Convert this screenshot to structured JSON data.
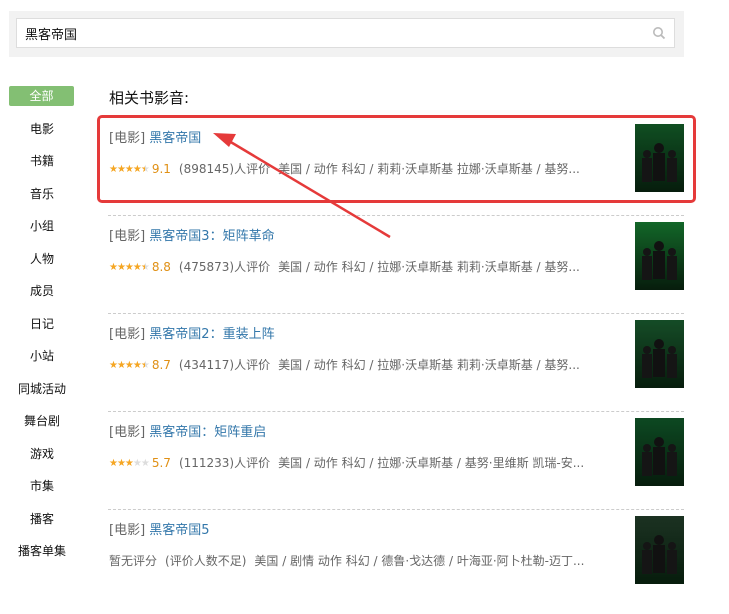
{
  "search": {
    "value": "黑客帝国"
  },
  "sidebar": {
    "items": [
      {
        "label": "全部",
        "active": true
      },
      {
        "label": "电影"
      },
      {
        "label": "书籍"
      },
      {
        "label": "音乐"
      },
      {
        "label": "小组"
      },
      {
        "label": "人物"
      },
      {
        "label": "成员"
      },
      {
        "label": "日记"
      },
      {
        "label": "小站"
      },
      {
        "label": "同城活动"
      },
      {
        "label": "舞台剧"
      },
      {
        "label": "游戏"
      },
      {
        "label": "市集"
      },
      {
        "label": "播客"
      },
      {
        "label": "播客单集"
      }
    ]
  },
  "section_title": "相关书影音:",
  "results": [
    {
      "category": "[电影]",
      "title": "黑客帝国",
      "stars": 4.5,
      "score": "9.1",
      "count": "(898145)人评价",
      "info": "美国 / 动作 科幻 / 莉莉·沃卓斯基 拉娜·沃卓斯基 / 基努...",
      "poster_color": "#0b3d1a"
    },
    {
      "category": "[电影]",
      "title": "黑客帝国3：矩阵革命",
      "stars": 4.5,
      "score": "8.8",
      "count": "(475873)人评价",
      "info": "美国 / 动作 科幻 / 拉娜·沃卓斯基 莉莉·沃卓斯基 / 基努...",
      "poster_color": "#0f5a22"
    },
    {
      "category": "[电影]",
      "title": "黑客帝国2：重装上阵",
      "stars": 4.5,
      "score": "8.7",
      "count": "(434117)人评价",
      "info": "美国 / 动作 科幻 / 拉娜·沃卓斯基 莉莉·沃卓斯基 / 基努...",
      "poster_color": "#123a20"
    },
    {
      "category": "[电影]",
      "title": "黑客帝国：矩阵重启",
      "stars": 3,
      "score": "5.7",
      "count": "(111233)人评价",
      "info": "美国 / 动作 科幻 / 拉娜·沃卓斯基 / 基努·里维斯 凯瑞-安...",
      "poster_color": "#08361a"
    },
    {
      "category": "[电影]",
      "title": "黑客帝国5",
      "no_rating": "暂无评分",
      "count": "(评价人数不足)",
      "info": "美国 / 剧情 动作 科幻 / 德鲁·戈达德 / 叶海亚·阿卜杜勒-迈丁...",
      "poster_color": "#1a1a1a"
    }
  ]
}
